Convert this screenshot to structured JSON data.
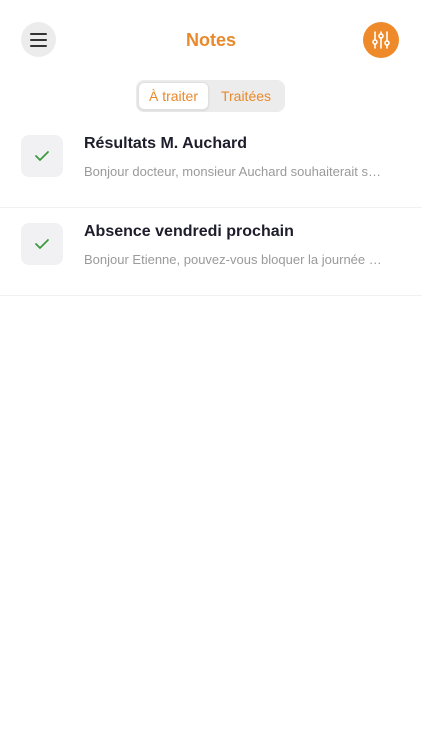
{
  "header": {
    "title": "Notes",
    "menu_icon": "hamburger-menu-icon",
    "filter_icon": "sliders-icon"
  },
  "tabs": [
    {
      "label": "À traiter",
      "active": true
    },
    {
      "label": "Traitées",
      "active": false
    }
  ],
  "notes": [
    {
      "title": "Résultats M. Auchard",
      "preview": "Bonjour docteur, monsieur Auchard souhaiterait savoir si ses résultats sont disponibles",
      "icon": "checkmark-icon"
    },
    {
      "title": "Absence vendredi prochain",
      "preview": "Bonjour Etienne, pouvez-vous bloquer la journée de vendredi prochain",
      "icon": "checkmark-icon"
    }
  ],
  "colors": {
    "accent": "#e8892b",
    "check": "#3d9a42",
    "title_text": "#1d1d2b",
    "preview_text": "#9a9a9a"
  }
}
